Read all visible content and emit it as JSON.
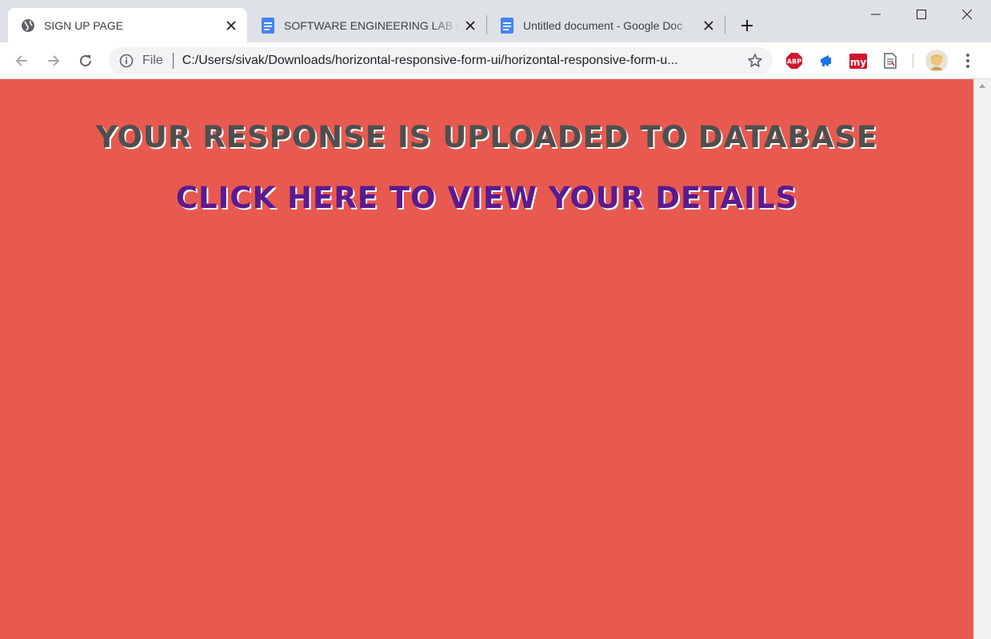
{
  "tabs": [
    {
      "title": "SIGN UP PAGE",
      "favicon": "globe-icon",
      "active": true
    },
    {
      "title": "SOFTWARE ENGINEERING LAB A",
      "favicon": "google-docs-icon",
      "active": false
    },
    {
      "title": "Untitled document - Google Doc",
      "favicon": "google-docs-icon",
      "active": false
    }
  ],
  "address_bar": {
    "scheme_label": "File",
    "url": "C:/Users/sivak/Downloads/horizontal-responsive-form-ui/horizontal-responsive-form-u..."
  },
  "extensions": [
    {
      "name": "adblock-plus-icon",
      "label": "ABP",
      "color": "#d2162c"
    },
    {
      "name": "megaphone-icon",
      "color": "#1a73e8"
    },
    {
      "name": "my-icon",
      "label": "my",
      "color": "#d2162c"
    },
    {
      "name": "document-icon",
      "color": "#5f6368"
    }
  ],
  "page": {
    "background": "#e85a4f",
    "heading": "YOUR RESPONSE IS UPLOADED TO DATABASE",
    "link_text": "CLICK HERE TO VIEW YOUR DETAILS"
  }
}
